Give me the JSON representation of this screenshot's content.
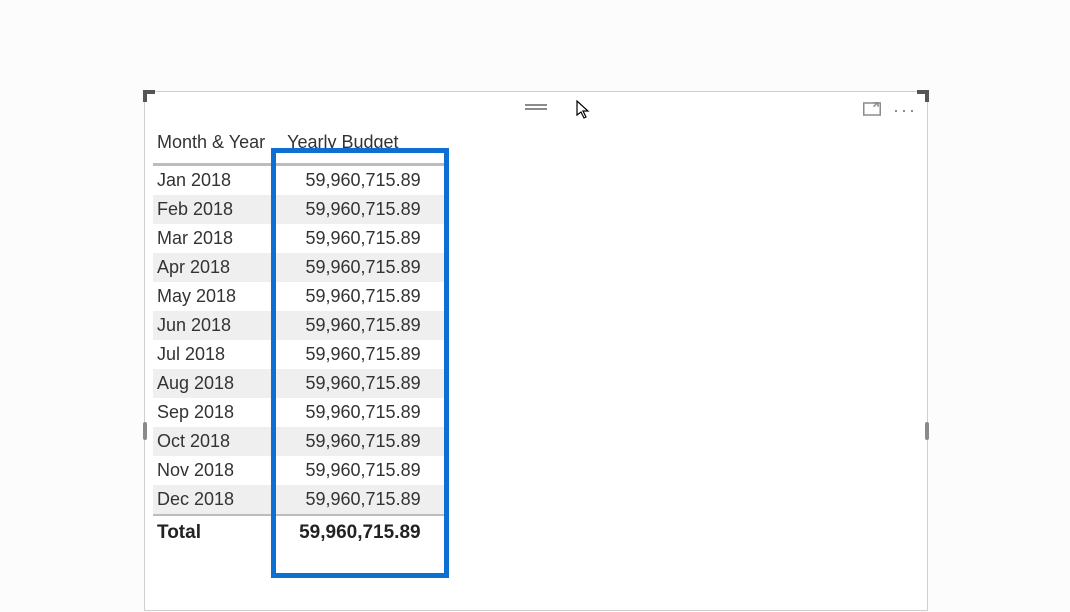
{
  "chart_data": {
    "type": "table",
    "columns": [
      "Month & Year",
      "Yearly Budget"
    ],
    "rows": [
      [
        "Jan 2018",
        "59,960,715.89"
      ],
      [
        "Feb 2018",
        "59,960,715.89"
      ],
      [
        "Mar 2018",
        "59,960,715.89"
      ],
      [
        "Apr 2018",
        "59,960,715.89"
      ],
      [
        "May 2018",
        "59,960,715.89"
      ],
      [
        "Jun 2018",
        "59,960,715.89"
      ],
      [
        "Jul 2018",
        "59,960,715.89"
      ],
      [
        "Aug 2018",
        "59,960,715.89"
      ],
      [
        "Sep 2018",
        "59,960,715.89"
      ],
      [
        "Oct 2018",
        "59,960,715.89"
      ],
      [
        "Nov 2018",
        "59,960,715.89"
      ],
      [
        "Dec 2018",
        "59,960,715.89"
      ]
    ],
    "total_label": "Total",
    "total_value": "59,960,715.89"
  },
  "columns": {
    "month": "Month & Year",
    "budget": "Yearly Budget"
  },
  "rows": [
    {
      "month": "Jan 2018",
      "budget": "59,960,715.89"
    },
    {
      "month": "Feb 2018",
      "budget": "59,960,715.89"
    },
    {
      "month": "Mar 2018",
      "budget": "59,960,715.89"
    },
    {
      "month": "Apr 2018",
      "budget": "59,960,715.89"
    },
    {
      "month": "May 2018",
      "budget": "59,960,715.89"
    },
    {
      "month": "Jun 2018",
      "budget": "59,960,715.89"
    },
    {
      "month": "Jul 2018",
      "budget": "59,960,715.89"
    },
    {
      "month": "Aug 2018",
      "budget": "59,960,715.89"
    },
    {
      "month": "Sep 2018",
      "budget": "59,960,715.89"
    },
    {
      "month": "Oct 2018",
      "budget": "59,960,715.89"
    },
    {
      "month": "Nov 2018",
      "budget": "59,960,715.89"
    },
    {
      "month": "Dec 2018",
      "budget": "59,960,715.89"
    }
  ],
  "total": {
    "label": "Total",
    "value": "59,960,715.89"
  },
  "highlight_color": "#0d6fd1"
}
